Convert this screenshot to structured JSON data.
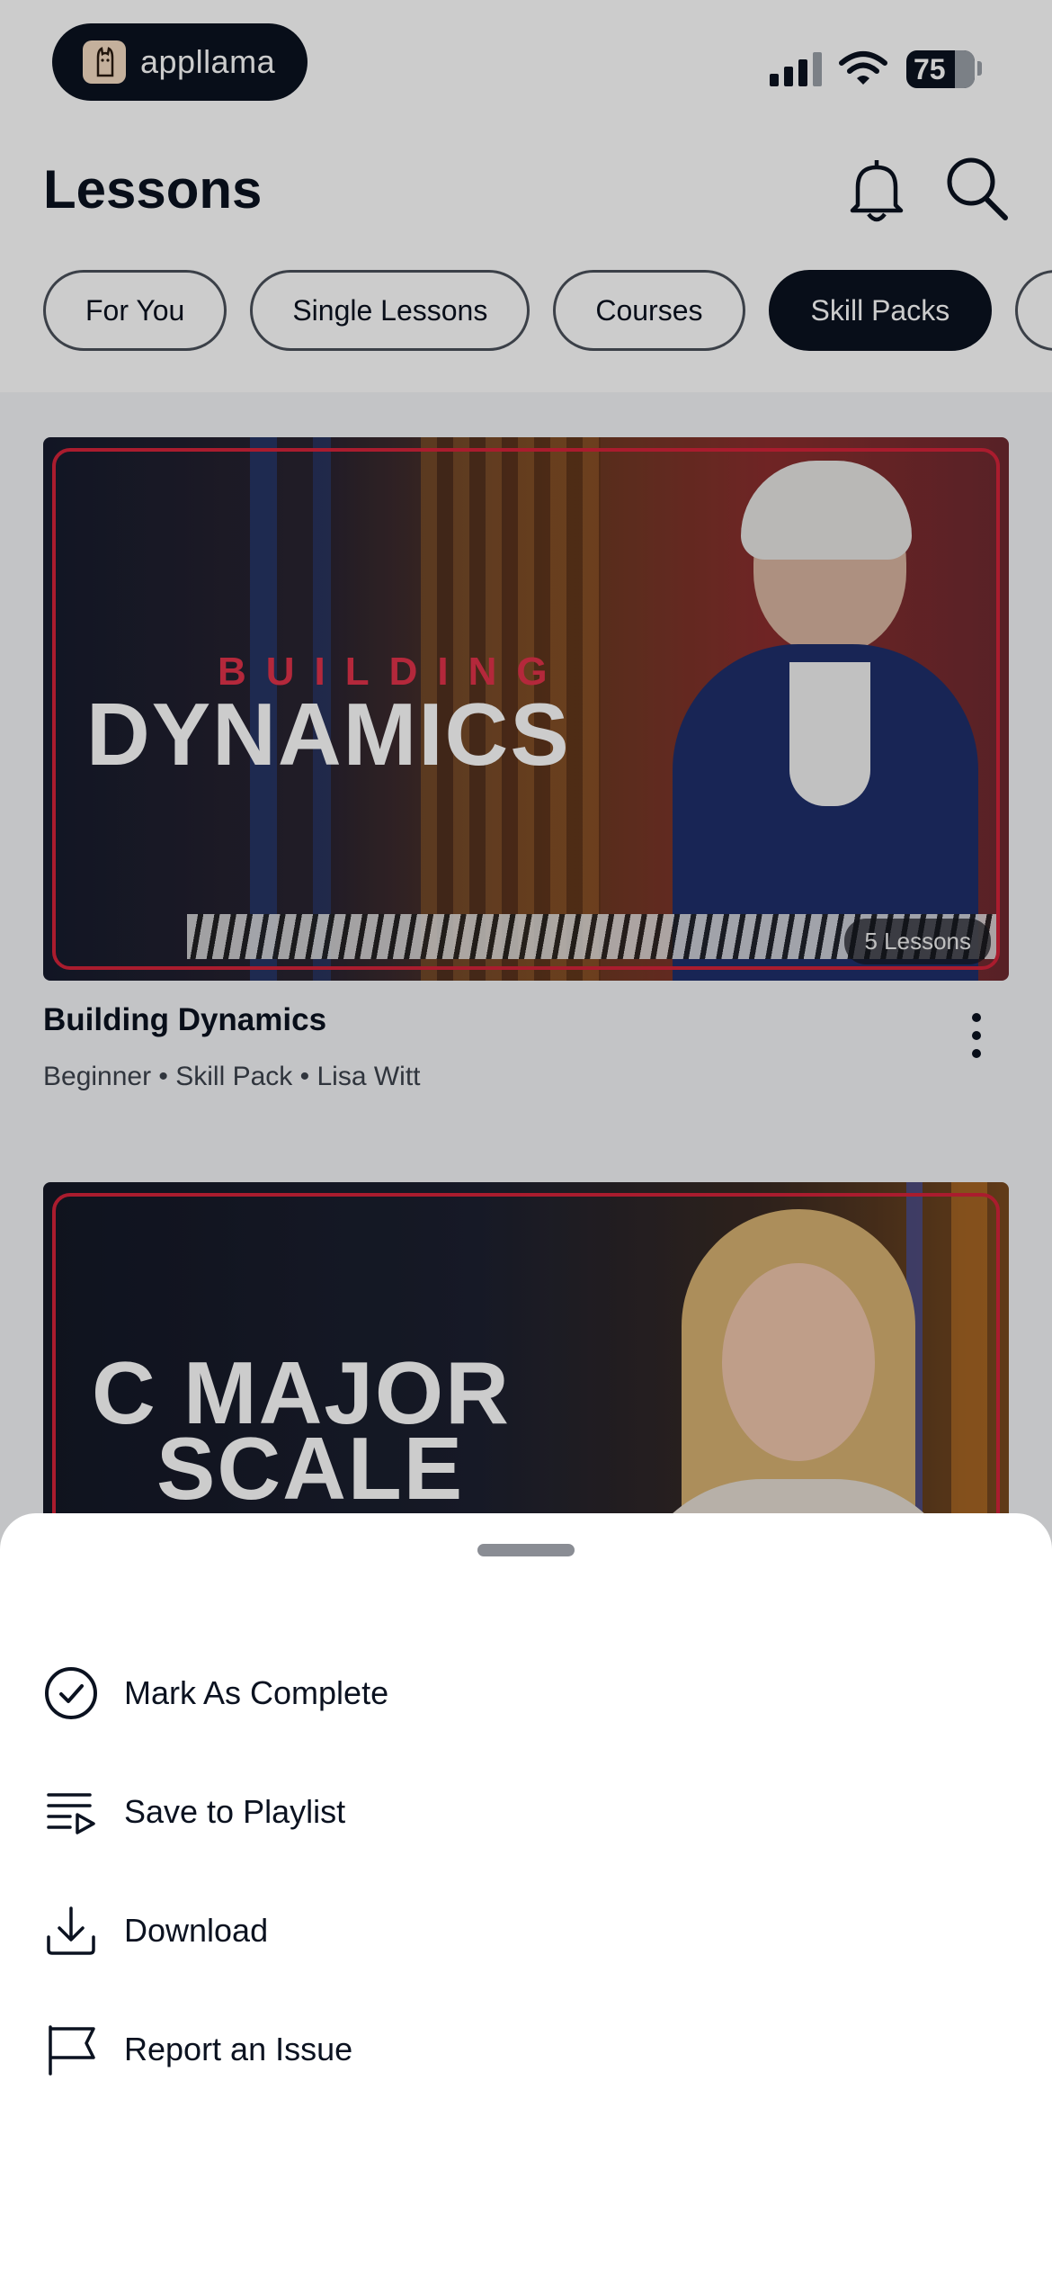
{
  "status_bar": {
    "app_name": "appllama",
    "battery": "75"
  },
  "header": {
    "title": "Lessons",
    "tabs": [
      {
        "label": "For You",
        "active": false
      },
      {
        "label": "Single Lessons",
        "active": false
      },
      {
        "label": "Courses",
        "active": false
      },
      {
        "label": "Skill Packs",
        "active": true
      }
    ]
  },
  "cards": [
    {
      "thumb_subtitle": "BUILDING",
      "thumb_title": "DYNAMICS",
      "badge": "5 Lessons",
      "title": "Building Dynamics",
      "meta": "Beginner • Skill Pack • Lisa Witt"
    },
    {
      "thumb_title_line1": "C MAJOR",
      "thumb_title_line2": "SCALE"
    }
  ],
  "sheet": {
    "items": [
      {
        "label": "Mark As Complete",
        "icon": "check-circle-icon"
      },
      {
        "label": "Save to Playlist",
        "icon": "playlist-add-icon"
      },
      {
        "label": "Download",
        "icon": "download-icon"
      },
      {
        "label": "Report an Issue",
        "icon": "flag-icon"
      }
    ]
  },
  "colors": {
    "brand_dark": "#0b1220",
    "accent_red": "#d5243a",
    "scrim": "rgba(0,0,0,0.2)"
  }
}
